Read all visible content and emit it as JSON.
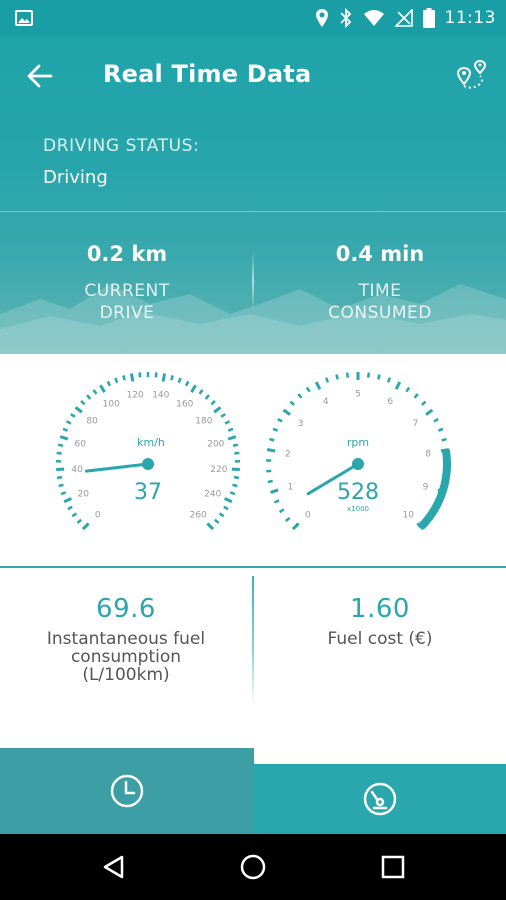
{
  "status_bar": {
    "time": "11:13",
    "icons": [
      "image-icon",
      "location-icon",
      "bluetooth-icon",
      "wifi-icon",
      "signal-icon",
      "battery-icon"
    ]
  },
  "header": {
    "title": "Real Time Data",
    "back_icon": "arrow-left-icon",
    "route_icon": "route-map-icon"
  },
  "driving": {
    "label": "DRIVING STATUS:",
    "value": "Driving"
  },
  "stats": {
    "current_drive_value": "0.2 km",
    "current_drive_label_1": "CURRENT",
    "current_drive_label_2": "DRIVE",
    "time_value": "0.4 min",
    "time_label_1": "TIME",
    "time_label_2": "CONSUMED"
  },
  "speed_gauge": {
    "unit": "km/h",
    "value": "37",
    "ticks": [
      "0",
      "20",
      "40",
      "60",
      "80",
      "100",
      "120",
      "140",
      "160",
      "180",
      "200",
      "220",
      "240",
      "260"
    ],
    "needle_value": 37
  },
  "rpm_gauge": {
    "unit": "rpm",
    "value": "528",
    "multiplier": "x1000",
    "ticks": [
      "0",
      "1",
      "2",
      "3",
      "4",
      "5",
      "6",
      "7",
      "8",
      "9",
      "10"
    ],
    "needle_value": 0.528
  },
  "fuel": {
    "instant_value": "69.6",
    "instant_label_1": "Instantaneous fuel",
    "instant_label_2": "consumption",
    "instant_label_3": "(L/100km)",
    "cost_value": "1.60",
    "cost_label": "Fuel cost (€)"
  },
  "tabs": {
    "left_icon": "clock-icon",
    "right_icon": "gauge-icon"
  },
  "nav": {
    "back_icon": "nav-back-icon",
    "home_icon": "nav-home-icon",
    "recents_icon": "nav-recents-icon"
  },
  "colors": {
    "primary": "#2aa6ad",
    "statusbar": "#1a9ea6",
    "tab_left": "#3d9ea6"
  }
}
